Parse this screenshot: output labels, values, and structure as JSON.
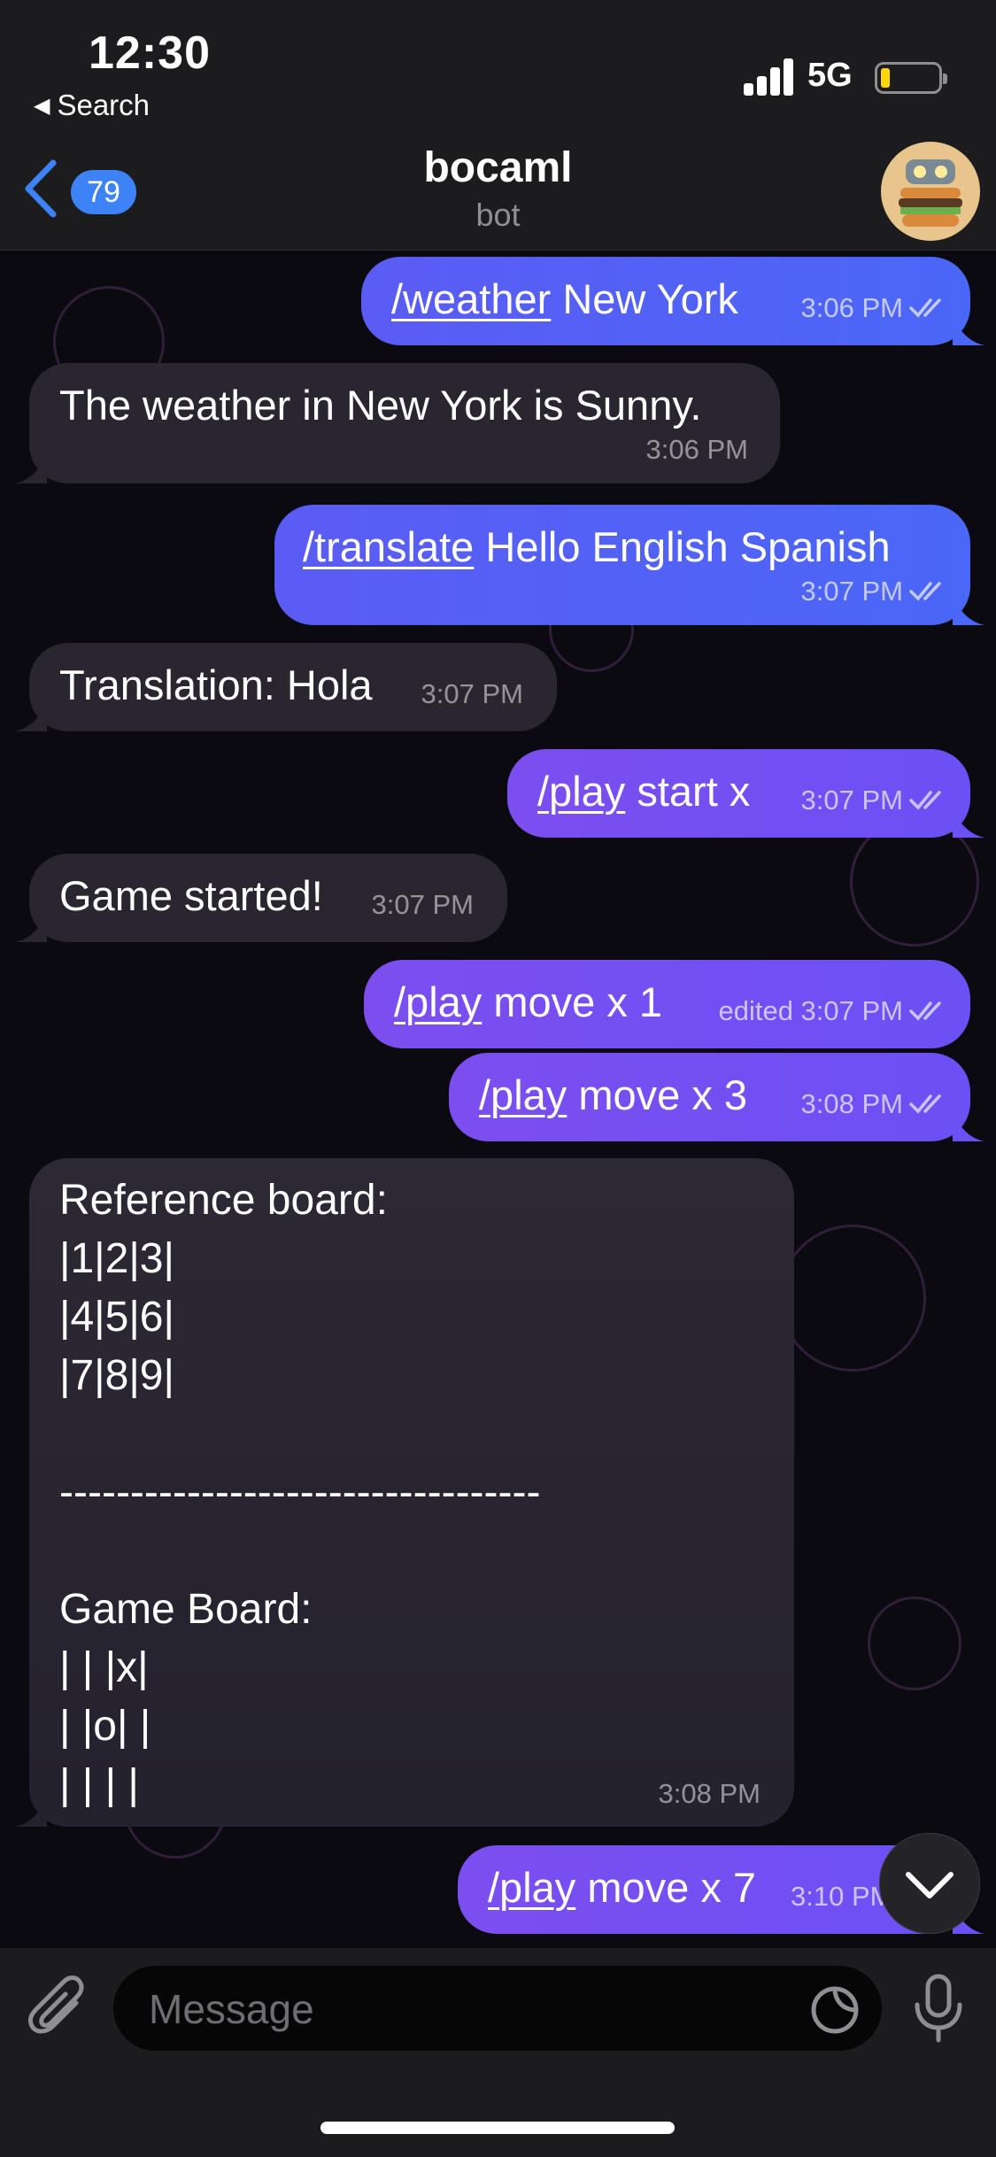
{
  "status_bar": {
    "time": "12:30",
    "back_app": "Search",
    "network": "5G",
    "battery_level": 0.15
  },
  "header": {
    "unread_count": "79",
    "title": "bocaml",
    "subtitle": "bot"
  },
  "messages": [
    {
      "dir": "out",
      "cmd": "/weather",
      "text": " New York",
      "time": "3:06 PM"
    },
    {
      "dir": "in",
      "text": "The weather in New York is Sunny.",
      "time": "3:06 PM"
    },
    {
      "dir": "out",
      "cmd": "/translate",
      "text": " Hello English Spanish",
      "time": "3:07 PM"
    },
    {
      "dir": "in",
      "text": "Translation: Hola",
      "time": "3:07 PM"
    },
    {
      "dir": "out",
      "cmd": "/play",
      "text": " start x",
      "time": "3:07 PM"
    },
    {
      "dir": "in",
      "text": "Game started!",
      "time": "3:07 PM"
    },
    {
      "dir": "out",
      "cmd": "/play",
      "text": " move x 1",
      "time": "edited 3:07 PM"
    },
    {
      "dir": "out",
      "cmd": "/play",
      "text": " move x 3",
      "time": "3:08 PM"
    },
    {
      "dir": "in",
      "lines": [
        "Reference board:",
        "|1|2|3|",
        "|4|5|6|",
        "|7|8|9|",
        "",
        "----------------------------------",
        "",
        "Game Board:",
        "| | |x|",
        "| |o| |",
        "| | | |"
      ],
      "time": "3:08 PM"
    },
    {
      "dir": "out",
      "cmd": "/play",
      "text": " move x 7",
      "time": "3:10 PM"
    }
  ],
  "input": {
    "placeholder": "Message"
  },
  "icons": {
    "back": "chevron-left-icon",
    "attach": "paperclip-icon",
    "sticker": "sticker-icon",
    "mic": "microphone-icon",
    "scroll": "chevron-down-icon",
    "read": "double-check-icon"
  },
  "colors": {
    "accent": "#3e82f7",
    "outgoing": "#5566f5",
    "incoming": "#2a2630"
  }
}
